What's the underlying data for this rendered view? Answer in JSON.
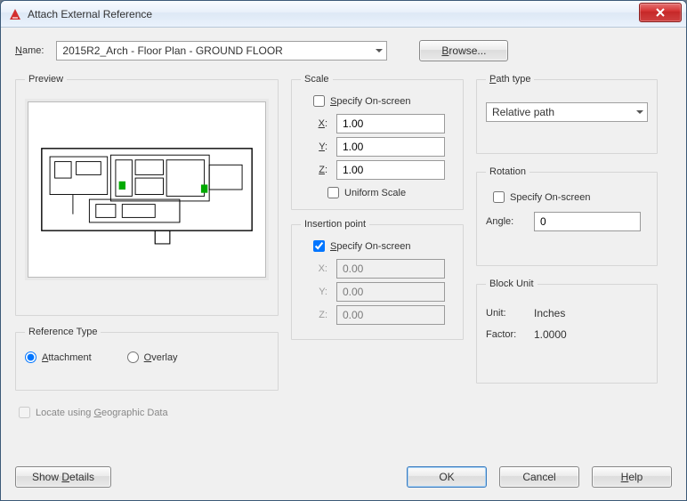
{
  "window": {
    "title": "Attach External Reference",
    "close_icon": "close-icon"
  },
  "name": {
    "label": "Name:",
    "label_u_char": "N",
    "value": "2015R2_Arch - Floor Plan - GROUND FLOOR",
    "browse_label": "Browse...",
    "browse_u_char": "B"
  },
  "preview": {
    "legend": "Preview"
  },
  "reference_type": {
    "legend": "Reference Type",
    "attachment_label": "Attachment",
    "attachment_u_char": "A",
    "overlay_label": "Overlay",
    "overlay_u_char": "O",
    "selected": "attachment"
  },
  "locate_geo": {
    "label": "Locate using Geographic Data",
    "u_char": "G",
    "enabled": false,
    "checked": false
  },
  "scale": {
    "legend": "Scale",
    "specify_label": "Specify On-screen",
    "specify_u_char": "S",
    "specify_checked": false,
    "x_label": "X:",
    "x_value": "1.00",
    "y_label": "Y:",
    "y_value": "1.00",
    "z_label": "Z:",
    "z_value": "1.00",
    "uniform_label": "Uniform Scale",
    "uniform_checked": false
  },
  "insertion": {
    "legend": "Insertion point",
    "specify_label": "Specify On-screen",
    "specify_u_char": "S",
    "specify_checked": true,
    "x_label": "X:",
    "x_value": "0.00",
    "y_label": "Y:",
    "y_value": "0.00",
    "z_label": "Z:",
    "z_value": "0.00"
  },
  "path_type": {
    "legend": "Path type",
    "legend_u_char": "P",
    "value": "Relative path"
  },
  "rotation": {
    "legend": "Rotation",
    "specify_label": "Specify On-screen",
    "specify_checked": false,
    "angle_label": "Angle:",
    "angle_value": "0"
  },
  "block_unit": {
    "legend": "Block Unit",
    "unit_label": "Unit:",
    "unit_value": "Inches",
    "factor_label": "Factor:",
    "factor_value": "1.0000"
  },
  "buttons": {
    "show_details": "Show Details",
    "show_details_u": "D",
    "ok": "OK",
    "cancel": "Cancel",
    "help": "Help",
    "help_u": "H"
  }
}
